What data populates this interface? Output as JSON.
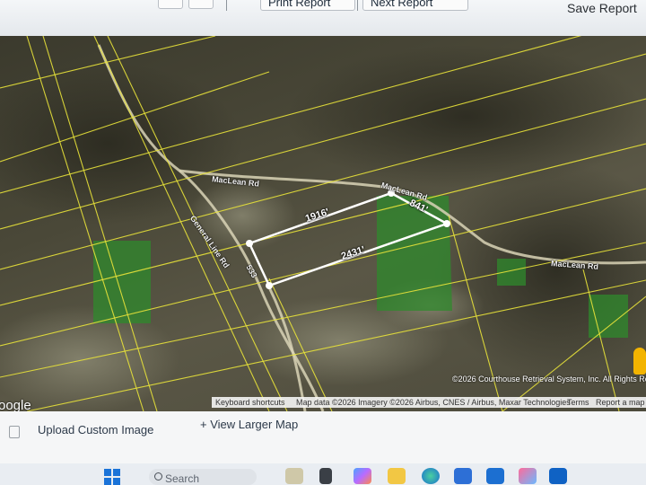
{
  "toolbar": {
    "print_report_label": "Print Report",
    "next_report_label": "Next Report",
    "save_report_label": "Save Report"
  },
  "map": {
    "roads": {
      "maclean_rd_west": "MacLean Rd",
      "maclean_rd_mid": "MacLean Rd",
      "maclean_rd_east": "MacLean Rd",
      "general_line_rd": "General Line Rd",
      "route_number": "533"
    },
    "dimensions": {
      "north": "1916'",
      "east": "841'",
      "south": "2431'"
    },
    "imagery_credit": "©2026 Courthouse Retrieval System, Inc. All Rights Reserv",
    "attribution": {
      "keyboard_shortcuts": "Keyboard shortcuts",
      "map_data": "Map data ©2026 Imagery ©2026 Airbus, CNES / Airbus, Maxar Technologies",
      "terms": "Terms",
      "report_error": "Report a map e"
    },
    "logo": "oogle",
    "icons": {
      "pegman": "pegman-icon"
    },
    "colors": {
      "parcel_lines": "#e8e23a",
      "selected_parcel": "#ffffff",
      "highlight_areas": "#2f8a2c"
    }
  },
  "lower": {
    "upload_custom_image": "Upload Custom Image",
    "view_larger_map": "+ View Larger Map"
  },
  "taskbar": {
    "search_placeholder": "Search",
    "icons": [
      "start-icon",
      "search-icon",
      "copilot-icon",
      "file-explorer-icon",
      "edge-icon",
      "store-icon",
      "app-icon",
      "photos-icon",
      "outlook-icon"
    ]
  }
}
